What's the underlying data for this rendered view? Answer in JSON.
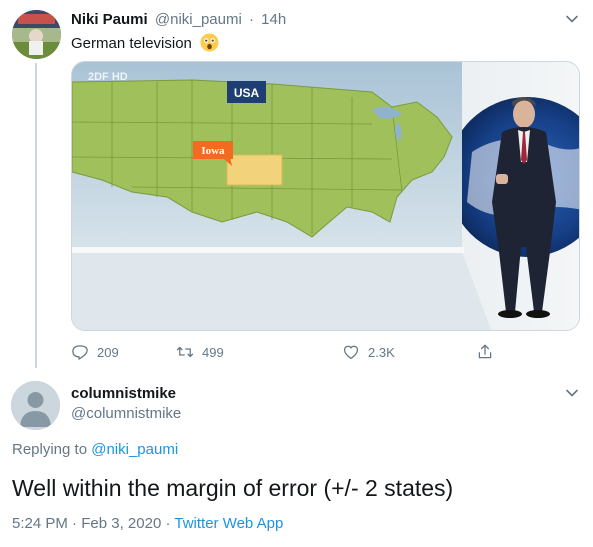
{
  "tweet": {
    "author_name": "Niki Paumi",
    "author_handle": "@niki_paumi",
    "separator": "·",
    "age": "14h",
    "text": "German television",
    "emoji": "astonished-face",
    "media": {
      "channel_logo": "2DF HD",
      "map_title": "USA",
      "map_label": "Iowa"
    },
    "stats": {
      "replies": "209",
      "retweets": "499",
      "likes": "2.3K"
    }
  },
  "reply": {
    "author_name": "columnistmike",
    "author_handle": "@columnistmike",
    "replying_prefix": "Replying to ",
    "replying_handle": "@niki_paumi",
    "text": "Well within the margin of error (+/- 2 states)",
    "time": "5:24 PM",
    "date": "Feb 3, 2020",
    "app": "Twitter Web App",
    "separator": "·"
  },
  "colors": {
    "link": "#1b95e0",
    "secondary_text": "#657786",
    "map_land": "#9fc05a",
    "highlight_state": "#f2d27a",
    "label_orange": "#f36a21"
  }
}
